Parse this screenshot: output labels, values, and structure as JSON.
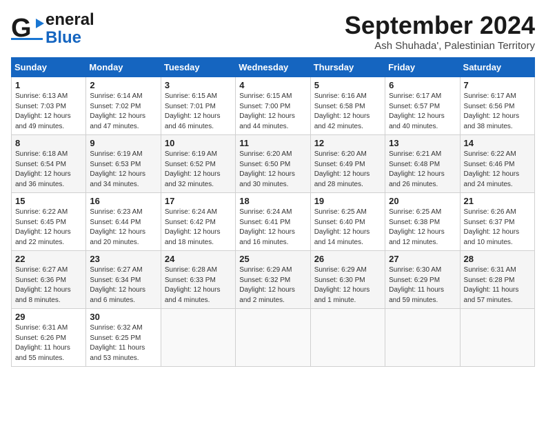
{
  "header": {
    "logo_line1": "General",
    "logo_line2": "Blue",
    "month": "September 2024",
    "location": "Ash Shuhada', Palestinian Territory"
  },
  "weekdays": [
    "Sunday",
    "Monday",
    "Tuesday",
    "Wednesday",
    "Thursday",
    "Friday",
    "Saturday"
  ],
  "weeks": [
    [
      {
        "day": "1",
        "detail": "Sunrise: 6:13 AM\nSunset: 7:03 PM\nDaylight: 12 hours\nand 49 minutes."
      },
      {
        "day": "2",
        "detail": "Sunrise: 6:14 AM\nSunset: 7:02 PM\nDaylight: 12 hours\nand 47 minutes."
      },
      {
        "day": "3",
        "detail": "Sunrise: 6:15 AM\nSunset: 7:01 PM\nDaylight: 12 hours\nand 46 minutes."
      },
      {
        "day": "4",
        "detail": "Sunrise: 6:15 AM\nSunset: 7:00 PM\nDaylight: 12 hours\nand 44 minutes."
      },
      {
        "day": "5",
        "detail": "Sunrise: 6:16 AM\nSunset: 6:58 PM\nDaylight: 12 hours\nand 42 minutes."
      },
      {
        "day": "6",
        "detail": "Sunrise: 6:17 AM\nSunset: 6:57 PM\nDaylight: 12 hours\nand 40 minutes."
      },
      {
        "day": "7",
        "detail": "Sunrise: 6:17 AM\nSunset: 6:56 PM\nDaylight: 12 hours\nand 38 minutes."
      }
    ],
    [
      {
        "day": "8",
        "detail": "Sunrise: 6:18 AM\nSunset: 6:54 PM\nDaylight: 12 hours\nand 36 minutes."
      },
      {
        "day": "9",
        "detail": "Sunrise: 6:19 AM\nSunset: 6:53 PM\nDaylight: 12 hours\nand 34 minutes."
      },
      {
        "day": "10",
        "detail": "Sunrise: 6:19 AM\nSunset: 6:52 PM\nDaylight: 12 hours\nand 32 minutes."
      },
      {
        "day": "11",
        "detail": "Sunrise: 6:20 AM\nSunset: 6:50 PM\nDaylight: 12 hours\nand 30 minutes."
      },
      {
        "day": "12",
        "detail": "Sunrise: 6:20 AM\nSunset: 6:49 PM\nDaylight: 12 hours\nand 28 minutes."
      },
      {
        "day": "13",
        "detail": "Sunrise: 6:21 AM\nSunset: 6:48 PM\nDaylight: 12 hours\nand 26 minutes."
      },
      {
        "day": "14",
        "detail": "Sunrise: 6:22 AM\nSunset: 6:46 PM\nDaylight: 12 hours\nand 24 minutes."
      }
    ],
    [
      {
        "day": "15",
        "detail": "Sunrise: 6:22 AM\nSunset: 6:45 PM\nDaylight: 12 hours\nand 22 minutes."
      },
      {
        "day": "16",
        "detail": "Sunrise: 6:23 AM\nSunset: 6:44 PM\nDaylight: 12 hours\nand 20 minutes."
      },
      {
        "day": "17",
        "detail": "Sunrise: 6:24 AM\nSunset: 6:42 PM\nDaylight: 12 hours\nand 18 minutes."
      },
      {
        "day": "18",
        "detail": "Sunrise: 6:24 AM\nSunset: 6:41 PM\nDaylight: 12 hours\nand 16 minutes."
      },
      {
        "day": "19",
        "detail": "Sunrise: 6:25 AM\nSunset: 6:40 PM\nDaylight: 12 hours\nand 14 minutes."
      },
      {
        "day": "20",
        "detail": "Sunrise: 6:25 AM\nSunset: 6:38 PM\nDaylight: 12 hours\nand 12 minutes."
      },
      {
        "day": "21",
        "detail": "Sunrise: 6:26 AM\nSunset: 6:37 PM\nDaylight: 12 hours\nand 10 minutes."
      }
    ],
    [
      {
        "day": "22",
        "detail": "Sunrise: 6:27 AM\nSunset: 6:36 PM\nDaylight: 12 hours\nand 8 minutes."
      },
      {
        "day": "23",
        "detail": "Sunrise: 6:27 AM\nSunset: 6:34 PM\nDaylight: 12 hours\nand 6 minutes."
      },
      {
        "day": "24",
        "detail": "Sunrise: 6:28 AM\nSunset: 6:33 PM\nDaylight: 12 hours\nand 4 minutes."
      },
      {
        "day": "25",
        "detail": "Sunrise: 6:29 AM\nSunset: 6:32 PM\nDaylight: 12 hours\nand 2 minutes."
      },
      {
        "day": "26",
        "detail": "Sunrise: 6:29 AM\nSunset: 6:30 PM\nDaylight: 12 hours\nand 1 minute."
      },
      {
        "day": "27",
        "detail": "Sunrise: 6:30 AM\nSunset: 6:29 PM\nDaylight: 11 hours\nand 59 minutes."
      },
      {
        "day": "28",
        "detail": "Sunrise: 6:31 AM\nSunset: 6:28 PM\nDaylight: 11 hours\nand 57 minutes."
      }
    ],
    [
      {
        "day": "29",
        "detail": "Sunrise: 6:31 AM\nSunset: 6:26 PM\nDaylight: 11 hours\nand 55 minutes."
      },
      {
        "day": "30",
        "detail": "Sunrise: 6:32 AM\nSunset: 6:25 PM\nDaylight: 11 hours\nand 53 minutes."
      },
      null,
      null,
      null,
      null,
      null
    ]
  ]
}
